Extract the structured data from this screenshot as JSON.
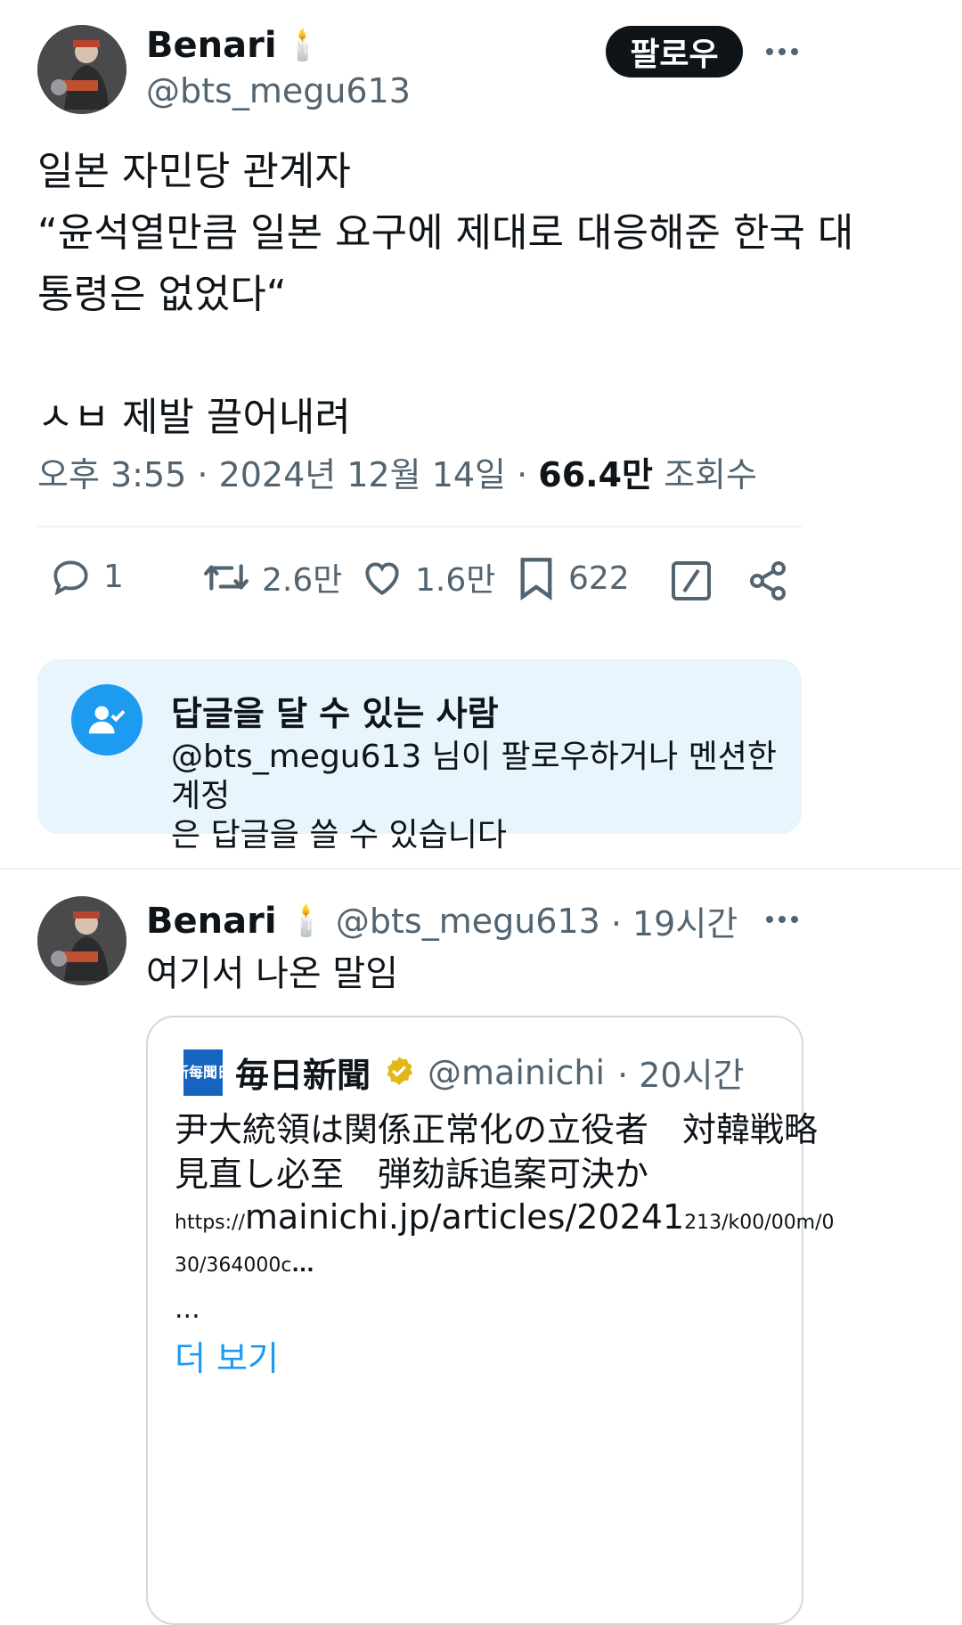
{
  "tweet": {
    "author_name": "Benari",
    "author_emoji": "🕯️",
    "author_handle": "@bts_megu613",
    "follow_label": "팔로우",
    "text": "일본 자민당 관계자\n“윤석열만큼 일본 요구에 제대로 대응해준 한국 대\n통령은 없었다“\n\nㅅㅂ 제발 끌어내려",
    "time": "오후 3:55 · 2024년 12월 14일 · ",
    "views_count": "66.4만",
    "views_label": " 조회수",
    "actions": {
      "reply_count": "1",
      "retweet_count": "2.6만",
      "like_count": "1.6만",
      "bookmark_count": "622"
    }
  },
  "reply_restriction": {
    "title": "답글을 달 수 있는 사람",
    "description": "@bts_megu613 님이 팔로우하거나 멘션한 계정\n은 답글을 쓸 수 있습니다"
  },
  "reply": {
    "author_name": "Benari",
    "author_emoji": "🕯️",
    "author_handle": "@bts_megu613",
    "time": "· 19시간",
    "text": "여기서 나온 말임",
    "quote": {
      "source_name": "毎日新聞",
      "source_handle": "@mainichi",
      "time": "· 20시간",
      "logo_text": "新每聞日",
      "line1": "尹大統領は関係正常化の立役者　対韓戦略",
      "line2": "見直し必至　弾劾訴追案可決か",
      "link_prefix": "https://",
      "link_main": "mainichi.jp/articles/20241",
      "link_rest": "213/k00/00m/0",
      "link_line2": "30/364000c",
      "ellipsis_inline": "...",
      "ellipsis": "...",
      "more_label": "더 보기"
    }
  },
  "colors": {
    "text": "#0f1419",
    "secondary": "#536471",
    "accent": "#1d9bf0",
    "reply_box_bg": "#e8f5fd",
    "border": "#cfd9de",
    "verified_gold": "#e2b719"
  },
  "icons": [
    "more-icon",
    "comment-icon",
    "retweet-icon",
    "heart-icon",
    "bookmark-icon",
    "grok-icon",
    "share-icon",
    "user-check-icon",
    "verified-badge-icon"
  ]
}
